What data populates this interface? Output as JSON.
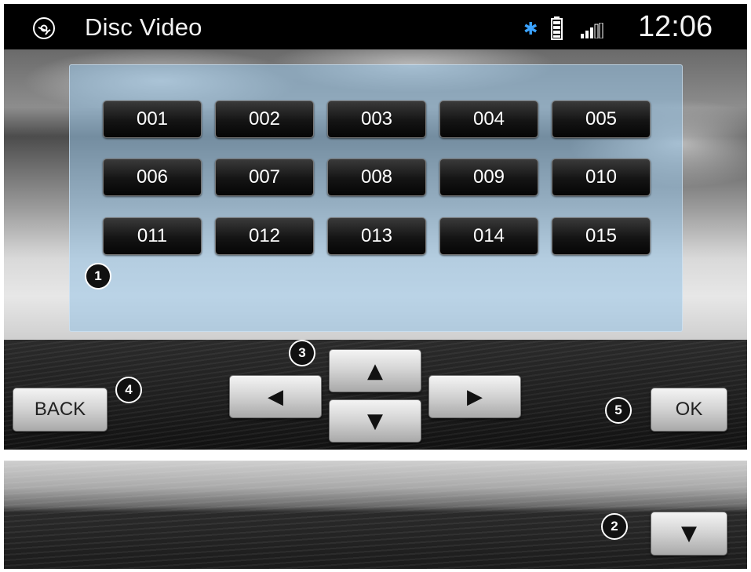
{
  "header": {
    "title": "Disc Video",
    "clock": "12:06",
    "icons": [
      "disc-icon",
      "bluetooth-icon",
      "battery-icon",
      "signal-icon"
    ],
    "bluetooth_glyph": "✱"
  },
  "tracks": [
    "001",
    "002",
    "003",
    "004",
    "005",
    "006",
    "007",
    "008",
    "009",
    "010",
    "011",
    "012",
    "013",
    "014",
    "015"
  ],
  "controls": {
    "back_label": "BACK",
    "ok_label": "OK",
    "up_glyph": "▲",
    "down_glyph": "▼",
    "left_glyph": "◀",
    "right_glyph": "▶"
  },
  "callouts": [
    "1",
    "2",
    "3",
    "4",
    "5"
  ],
  "strip": {
    "scroll_down_glyph": "▼"
  },
  "colors": {
    "bluetooth": "#3aa2ff",
    "panel": "#96c3e6"
  }
}
